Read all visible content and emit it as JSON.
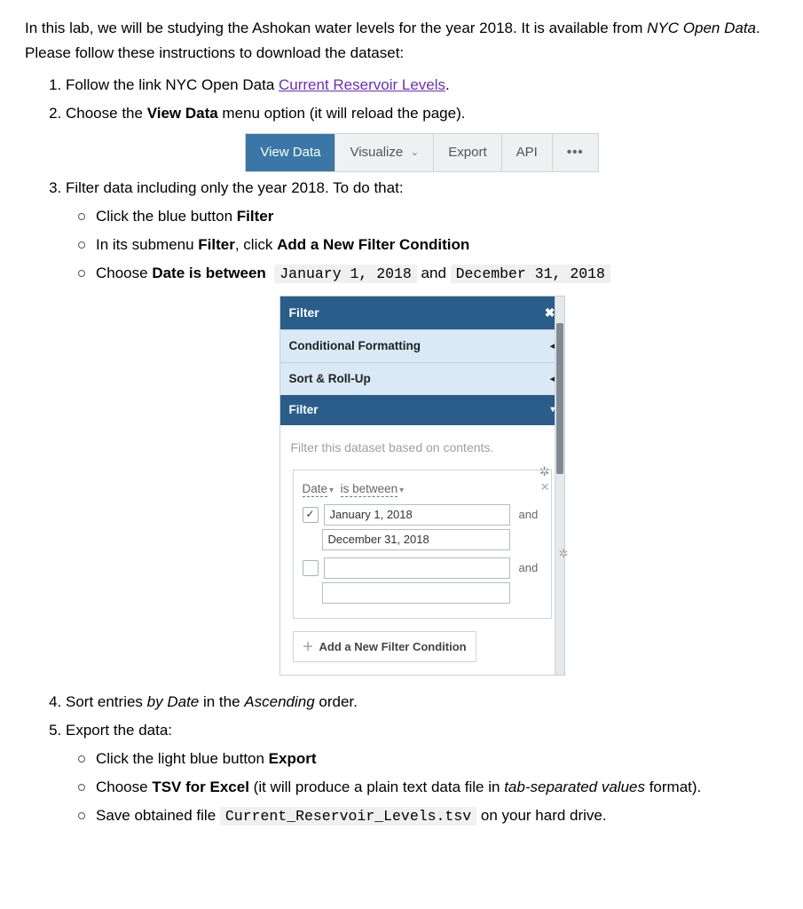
{
  "intro": {
    "part1": "In this lab, we will be studying the Ashokan water levels for the year 2018. It is available from ",
    "source": "NYC Open Data",
    "part2": ". Please follow these instructions to download the dataset:"
  },
  "step1": {
    "pre": "Follow the link NYC Open Data ",
    "link": "Current Reservoir Levels",
    "post": "."
  },
  "step2": {
    "pre": "Choose the ",
    "bold": "View Data",
    "post": " menu option (it will reload the page)."
  },
  "toolbar": {
    "viewdata": "View Data",
    "visualize": "Visualize",
    "export": "Export",
    "api": "API",
    "more": "•••"
  },
  "step3": {
    "lead": "Filter data including only the year 2018. To do that:",
    "a_pre": "Click the blue button ",
    "a_bold": "Filter",
    "b_pre": "In its submenu ",
    "b_bold1": "Filter",
    "b_mid": ", click ",
    "b_bold2": "Add a New Filter Condition",
    "c_pre": "Choose ",
    "c_bold": "Date is between",
    "c_code1": "January 1, 2018",
    "c_and": " and ",
    "c_code2": "December 31, 2018"
  },
  "panel": {
    "title": "Filter",
    "row1": "Conditional Formatting",
    "row2": "Sort & Roll-Up",
    "subtitle": "Filter",
    "hint": "Filter this dataset based on contents.",
    "field": "Date",
    "op": "is between",
    "val1": "January 1, 2018",
    "val2": "December 31, 2018",
    "and": "and",
    "addnew": "Add a New Filter Condition"
  },
  "step4": {
    "pre": "Sort entries ",
    "em1": "by Date",
    "mid": " in the ",
    "em2": "Ascending",
    "post": " order."
  },
  "step5": {
    "lead": "Export the data:",
    "a_pre": "Click the light blue button ",
    "a_bold": "Export",
    "b_pre": "Choose ",
    "b_bold": "TSV for Excel",
    "b_mid": " (it will produce a plain text data file in ",
    "b_em": "tab-separated values",
    "b_post": " format).",
    "c_pre": "Save obtained file ",
    "c_code": "Current_Reservoir_Levels.tsv",
    "c_post": " on your hard drive."
  }
}
